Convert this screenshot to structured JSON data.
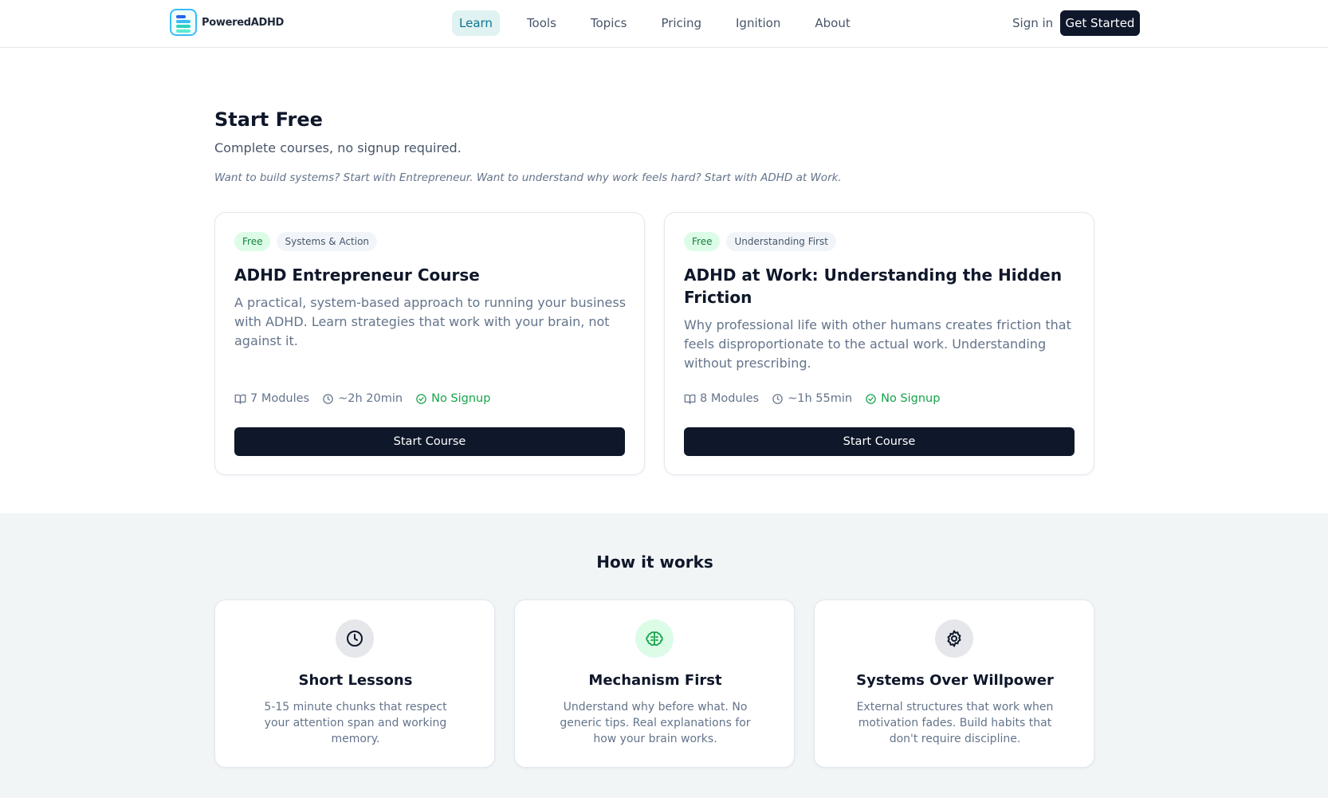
{
  "header": {
    "brand": "PoweredADHD",
    "nav": [
      {
        "label": "Learn",
        "active": true
      },
      {
        "label": "Tools"
      },
      {
        "label": "Topics"
      },
      {
        "label": "Pricing"
      },
      {
        "label": "Ignition"
      },
      {
        "label": "About"
      }
    ],
    "sign_in": "Sign in",
    "get_started": "Get Started"
  },
  "start_free": {
    "title": "Start Free",
    "subtitle": "Complete courses, no signup required.",
    "note": "Want to build systems? Start with Entrepreneur. Want to understand why work feels hard? Start with ADHD at Work.",
    "courses": [
      {
        "tag_free": "Free",
        "tag_category": "Systems & Action",
        "title": "ADHD Entrepreneur Course",
        "description": "A practical, system-based approach to running your business with ADHD. Learn strategies that work with your brain, not against it.",
        "modules": "7 Modules",
        "duration": "~2h 20min",
        "signup": "No Signup",
        "button": "Start Course"
      },
      {
        "tag_free": "Free",
        "tag_category": "Understanding First",
        "title": "ADHD at Work: Understanding the Hidden Friction",
        "description": "Why professional life with other humans creates friction that feels disproportionate to the actual work. Understanding without prescribing.",
        "modules": "8 Modules",
        "duration": "~1h 55min",
        "signup": "No Signup",
        "button": "Start Course"
      }
    ]
  },
  "how_it_works": {
    "title": "How it works",
    "features": [
      {
        "icon": "clock-icon",
        "title": "Short Lessons",
        "description": "5-15 minute chunks that respect your attention span and working memory."
      },
      {
        "icon": "brain-icon",
        "title": "Mechanism First",
        "description": "Understand why before what. No generic tips. Real explanations for how your brain works."
      },
      {
        "icon": "gear-icon",
        "title": "Systems Over Willpower",
        "description": "External structures that work when motivation fades. Build habits that don't require discipline."
      }
    ]
  },
  "colors": {
    "primary": "#0f172a",
    "accent_teal": "#0e7490",
    "success": "#16a34a",
    "muted_bg": "#f1f5f5"
  }
}
